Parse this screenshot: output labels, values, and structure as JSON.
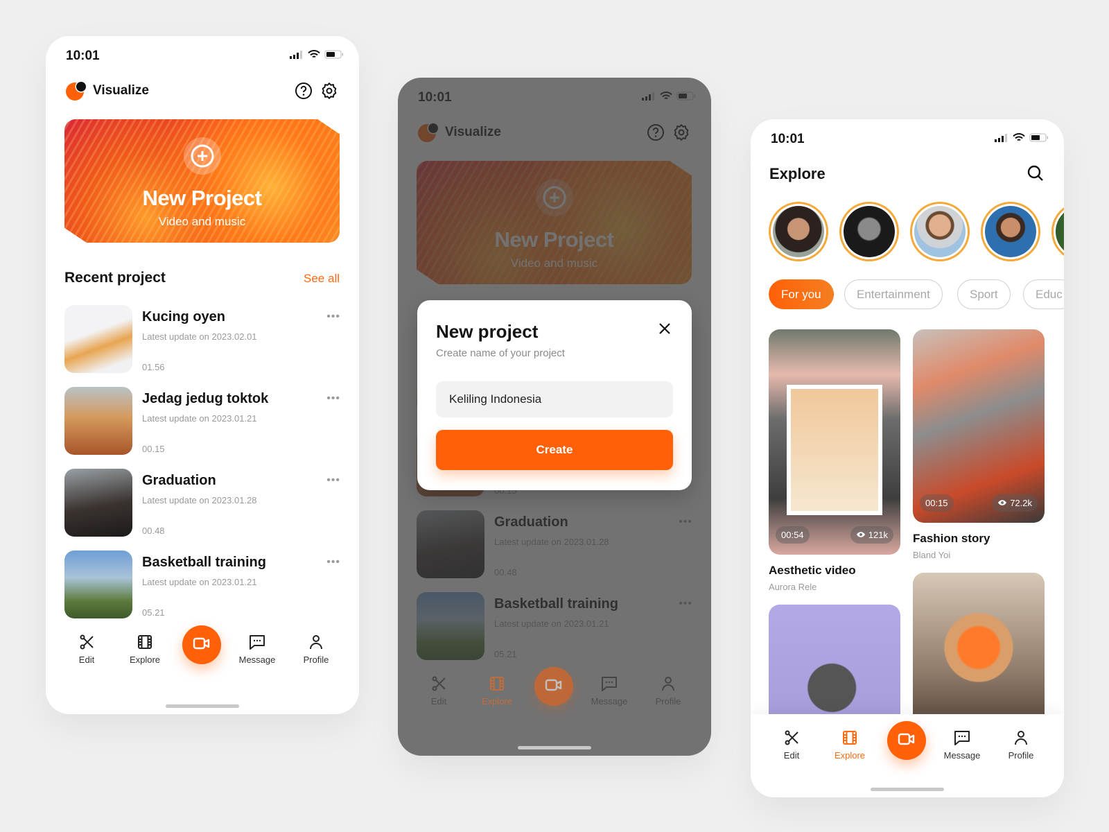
{
  "accent": "#ff6008",
  "status": {
    "time": "10:01"
  },
  "app": {
    "name": "Visualize"
  },
  "banner": {
    "title": "New Project",
    "subtitle": "Video and music"
  },
  "recent": {
    "title": "Recent project",
    "see_all": "See all",
    "projects": [
      {
        "title": "Kucing oyen",
        "updated": "Latest update on 2023.02.01",
        "duration": "01.56"
      },
      {
        "title": "Jedag jedug toktok",
        "updated": "Latest update on 2023.01.21",
        "duration": "00.15"
      },
      {
        "title": "Graduation",
        "updated": "Latest update on 2023.01.28",
        "duration": "00.48"
      },
      {
        "title": "Basketball training",
        "updated": "Latest update on 2023.01.21",
        "duration": "05.21"
      }
    ]
  },
  "nav": [
    {
      "label": "Edit",
      "icon": "scissors-icon"
    },
    {
      "label": "Explore",
      "icon": "film-icon"
    },
    {
      "label": "",
      "icon": "video-camera-icon"
    },
    {
      "label": "Message",
      "icon": "message-icon"
    },
    {
      "label": "Profile",
      "icon": "person-icon"
    }
  ],
  "modal": {
    "title": "New project",
    "subtitle": "Create name of your project",
    "input_value": "Keliling Indonesia",
    "create_label": "Create"
  },
  "explore": {
    "title": "Explore",
    "chips": [
      "For you",
      "Entertainment",
      "Sport",
      "Educ"
    ],
    "videos": [
      {
        "title": "Aesthetic video",
        "author": "Aurora Rele",
        "duration": "00:54",
        "views": "121k"
      },
      {
        "title": "Fashion story",
        "author": "Bland Yoi",
        "duration": "00:15",
        "views": "72.2k"
      }
    ]
  }
}
